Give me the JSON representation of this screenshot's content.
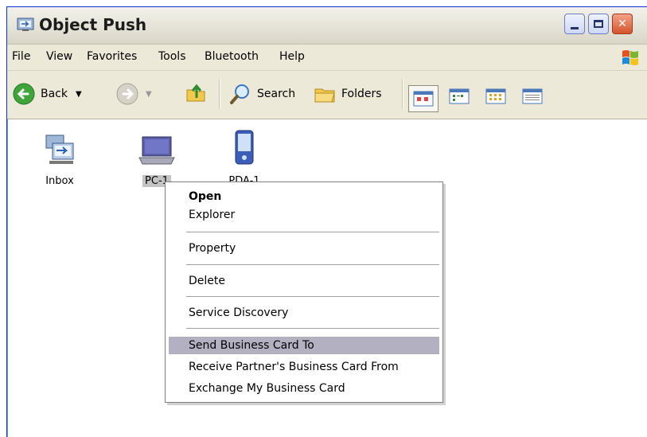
{
  "window": {
    "title": "Object Push"
  },
  "menubar": {
    "items": [
      "File",
      "View",
      "Favorites",
      "Tools",
      "Bluetooth",
      "Help"
    ]
  },
  "toolbar": {
    "back_label": "Back",
    "search_label": "Search",
    "folders_label": "Folders"
  },
  "devices": [
    {
      "label": "Inbox",
      "icon": "inbox-icon"
    },
    {
      "label": "PC-1",
      "icon": "laptop-icon",
      "selected": true
    },
    {
      "label": "PDA-1",
      "icon": "pda-icon"
    }
  ],
  "context_menu": {
    "items": [
      "Open",
      "Explorer",
      "Property",
      "Delete",
      "Service Discovery",
      "Send Business Card To",
      "Receive Partner's Business Card From",
      "Exchange My Business Card"
    ],
    "highlighted": "Send Business Card To"
  },
  "colors": {
    "title_bar": "#e4e2d6",
    "menu_highlight": "#b3b0c2",
    "close_button": "#d4542c"
  }
}
